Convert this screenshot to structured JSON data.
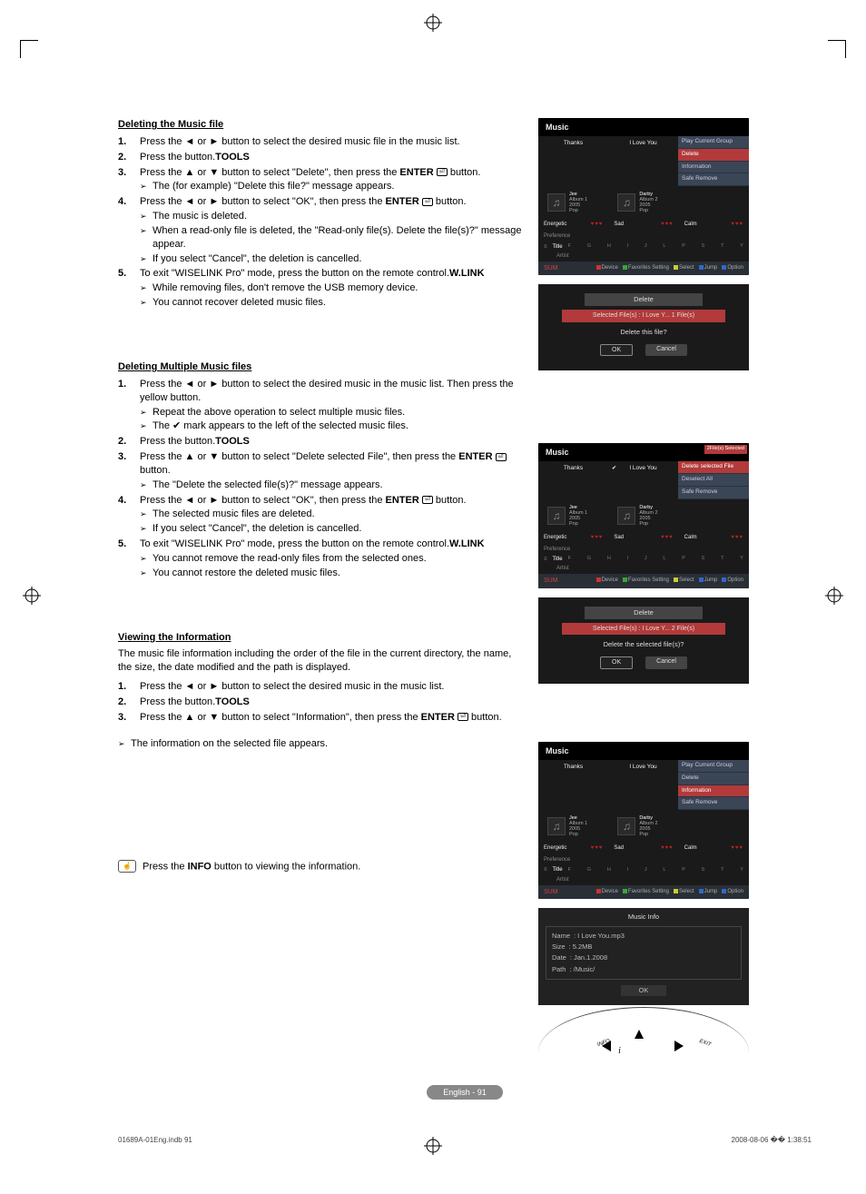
{
  "glyphs": {
    "left": "◄",
    "right": "►",
    "up": "▲",
    "down": "▼",
    "check": "✔",
    "sub": "➢"
  },
  "section1": {
    "heading": "Deleting the Music file",
    "steps": [
      {
        "n": "1.",
        "body": [
          {
            "t": "text",
            "pre": "Press the ",
            "g1": "◄",
            "mid": " or ",
            "g2": "►",
            "post": " button to select the desired music file in the music list."
          }
        ]
      },
      {
        "n": "2.",
        "body": [
          {
            "t": "text",
            "pre": "Press the ",
            "bold": "TOOLS",
            "post": " button."
          }
        ]
      },
      {
        "n": "3.",
        "body": [
          {
            "t": "text",
            "pre": "Press the ",
            "g1": "▲",
            "mid": " or ",
            "g2": "▼",
            "post": " button to select \"Delete\", then press the ",
            "bold": "ENTER",
            "icon": true,
            "post2": " button."
          },
          {
            "t": "sub",
            "val": "The (for example) \"Delete this file?\" message appears."
          }
        ]
      },
      {
        "n": "4.",
        "body": [
          {
            "t": "text",
            "pre": "Press the ",
            "g1": "◄",
            "mid": " or ",
            "g2": "►",
            "post": " button to select \"OK\", then press the ",
            "bold": "ENTER",
            "icon": true,
            "post2": " button."
          },
          {
            "t": "sub",
            "val": "The music is deleted."
          },
          {
            "t": "sub",
            "val": "When a read-only file is deleted, the \"Read-only file(s). Delete the file(s)?\" message appear."
          },
          {
            "t": "sub",
            "val": "If you select \"Cancel\", the deletion is cancelled."
          }
        ]
      },
      {
        "n": "5.",
        "body": [
          {
            "t": "text",
            "pre": "To exit \"WISELINK Pro\" mode, press the ",
            "bold": "W.LINK",
            "post": " button on the remote control."
          },
          {
            "t": "sub",
            "val": "While removing files, don't remove the USB memory device."
          },
          {
            "t": "sub",
            "val": "You cannot recover deleted music files."
          }
        ]
      }
    ]
  },
  "section2": {
    "heading": "Deleting Multiple Music files",
    "steps": [
      {
        "n": "1.",
        "body": [
          {
            "t": "text",
            "pre": "Press the ",
            "g1": "◄",
            "mid": " or ",
            "g2": "►",
            "post": " button to select the desired music in the music list. Then press the yellow button."
          },
          {
            "t": "sub",
            "val": "Repeat the above operation to select multiple music files."
          },
          {
            "t": "sub",
            "pre": "The ",
            "check": true,
            "post": " mark appears to the left of the selected music files."
          }
        ]
      },
      {
        "n": "2.",
        "body": [
          {
            "t": "text",
            "pre": "Press the ",
            "bold": "TOOLS",
            "post": " button."
          }
        ]
      },
      {
        "n": "3.",
        "body": [
          {
            "t": "text",
            "pre": "Press the ",
            "g1": "▲",
            "mid": " or ",
            "g2": "▼",
            "post": " button to select \"Delete selected File\", then press the ",
            "bold": "ENTER",
            "icon": true,
            "post2": " button."
          },
          {
            "t": "sub",
            "val": "The \"Delete the selected file(s)?\" message appears."
          }
        ]
      },
      {
        "n": "4.",
        "body": [
          {
            "t": "text",
            "pre": "Press the ",
            "g1": "◄",
            "mid": " or ",
            "g2": "►",
            "post": " button to select \"OK\", then press the ",
            "bold": "ENTER",
            "icon": true,
            "post2": " button."
          },
          {
            "t": "sub",
            "val": "The selected music files are deleted."
          },
          {
            "t": "sub",
            "val": "If you select \"Cancel\", the deletion is cancelled."
          }
        ]
      },
      {
        "n": "5.",
        "body": [
          {
            "t": "text",
            "pre": "To exit \"WISELINK Pro\" mode, press the ",
            "bold": "W.LINK",
            "post": " button on the remote control."
          },
          {
            "t": "sub",
            "val": "You cannot remove the read-only files from the selected ones."
          },
          {
            "t": "sub",
            "val": "You cannot restore the deleted music files."
          }
        ]
      }
    ]
  },
  "section3": {
    "heading": "Viewing the Information",
    "intro": "The music file information including the order of the file in the current directory, the name, the size, the date modified and the path is displayed.",
    "steps": [
      {
        "n": "1.",
        "body": [
          {
            "t": "text",
            "pre": "Press the ",
            "g1": "◄",
            "mid": " or ",
            "g2": "►",
            "post": " button to select the desired music in the music list."
          }
        ]
      },
      {
        "n": "2.",
        "body": [
          {
            "t": "text",
            "pre": "Press the ",
            "bold": "TOOLS",
            "post": " button."
          }
        ]
      },
      {
        "n": "3.",
        "body": [
          {
            "t": "text",
            "pre": "Press the ",
            "g1": "▲",
            "mid": " or ",
            "g2": "▼",
            "post": " button to select \"Information\", then press the ",
            "bold": "ENTER",
            "icon": true,
            "post2": " button."
          }
        ]
      }
    ],
    "tail_sub": "The information on the selected file appears.",
    "info_tip": {
      "pre": "Press the ",
      "bold": "INFO",
      "post": " button to viewing the information."
    }
  },
  "osd_common": {
    "title": "Music",
    "thumb1": {
      "top": "Thanks",
      "name": "Jee",
      "a": "Album 1",
      "y": "2005",
      "g": "Pop"
    },
    "thumb2": {
      "top": "I Love You",
      "name": "Darby",
      "a": "Album 2",
      "y": "2005",
      "g": "Pop"
    },
    "moods": [
      "Energetic",
      "Sad",
      "Calm"
    ],
    "pref": "Preference",
    "sort_title": "Title",
    "sort_artist": "Artist",
    "letters": [
      "F",
      "G",
      "H",
      "I",
      "J",
      "L",
      "P",
      "S",
      "T",
      "Y"
    ],
    "sum": "SUM",
    "bb": [
      "Device",
      "Favorites Setting",
      "Select",
      "Jump",
      "Option"
    ]
  },
  "osd1_menu": [
    "Play Current Group",
    "Delete",
    "Information",
    "Safe Remove"
  ],
  "osd1_menu_hl": 1,
  "dialog1": {
    "title": "Delete",
    "sel": "Selected File(s) : I Love Y...   1 File(s)",
    "msg": "Delete this file?",
    "ok": "OK",
    "cancel": "Cancel"
  },
  "osd2_badge": "2File(s) Selected",
  "osd2_menu": [
    "Delete selected File",
    "Deselect All",
    "Safe Remove"
  ],
  "osd2_menu_hl": 0,
  "dialog2": {
    "title": "Delete",
    "sel": "Selected File(s) : I Love Y...   2 File(s)",
    "msg": "Delete the selected file(s)?",
    "ok": "OK",
    "cancel": "Cancel"
  },
  "osd3_menu": [
    "Play Current Group",
    "Delete",
    "Information",
    "Safe Remove"
  ],
  "osd3_menu_hl": 2,
  "info_panel": {
    "title": "Music Info",
    "name_l": "Name",
    "name_v": ": I Love You.mp3",
    "size_l": "Size",
    "size_v": ": 5.2MB",
    "date_l": "Date",
    "date_v": ": Jan.1.2008",
    "path_l": "Path",
    "path_v": ": /Music/",
    "ok": "OK"
  },
  "remote": {
    "info": "INFO",
    "exit": "EXIT"
  },
  "footer": {
    "page": "English - 91",
    "meta_left": "01689A-01Eng.indb   91",
    "meta_right": "2008-08-06   �� 1:38:51"
  }
}
